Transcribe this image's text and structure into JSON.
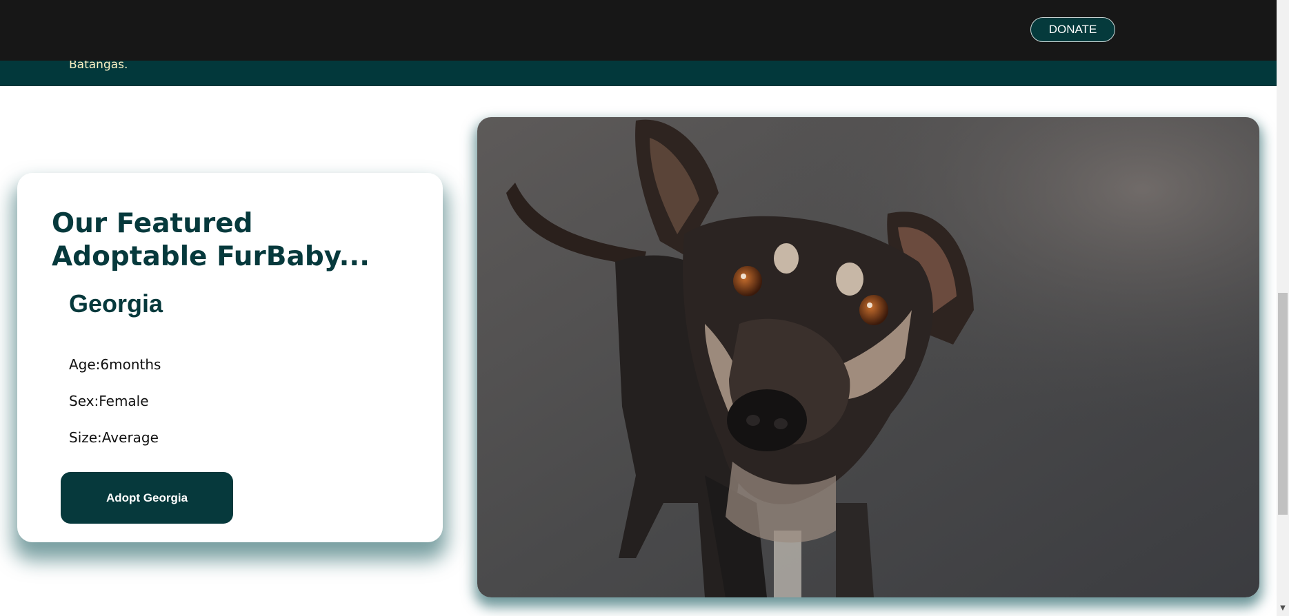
{
  "header": {
    "donate_label": "DONATE"
  },
  "hero_band": {
    "text": "Batangas."
  },
  "featured": {
    "title": "Our Featured Adoptable FurBaby...",
    "pet_name": "Georgia",
    "age": "Age:6months",
    "sex": "Sex:Female",
    "size": "Size:Average",
    "adopt_label": "Adopt Georgia"
  },
  "photo": {
    "icon": "dog-photo"
  },
  "colors": {
    "topbar": "#171717",
    "brand_teal": "#06393c",
    "band_text": "#fbf1c4"
  }
}
